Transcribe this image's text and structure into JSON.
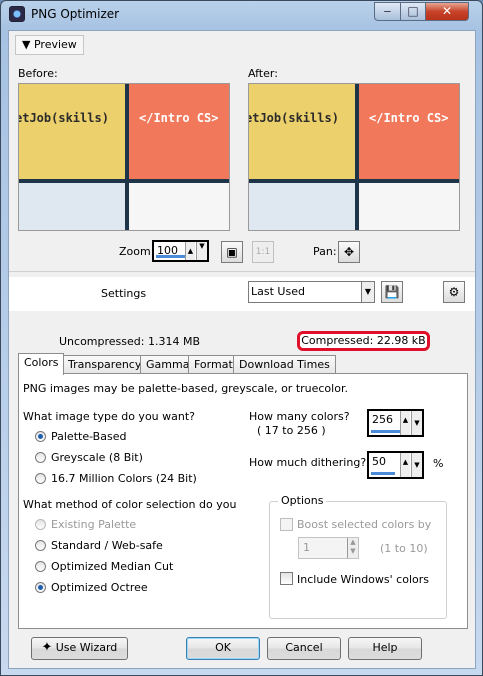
{
  "window": {
    "title": "PNG Optimizer"
  },
  "titlebar": {
    "min_glyph": "‒",
    "max_glyph": "□",
    "close_glyph": "✕"
  },
  "preview": {
    "toggle_label": "Preview",
    "before_label": "Before:",
    "after_label": "After:",
    "tile_yellow_text": "etJob(skills)",
    "tile_red_text": "</Intro CS>"
  },
  "zoom": {
    "label": "Zoom:",
    "value": "100"
  },
  "pan": {
    "label": "Pan:"
  },
  "settings": {
    "label": "Settings",
    "preset": "Last Used"
  },
  "sizes": {
    "uncompressed": "Uncompressed:  1.314 MB",
    "compressed": "Compressed: 22.98 kB"
  },
  "tabs": [
    "Colors",
    "Transparency",
    "Gamma",
    "Format",
    "Download Times"
  ],
  "colors_tab": {
    "intro": "PNG images may be palette-based, greyscale, or truecolor.",
    "type_question": "What image type do you want?",
    "type_options": [
      "Palette-Based",
      "Greyscale (8 Bit)",
      "16.7 Million Colors (24 Bit)"
    ],
    "type_selected": 0,
    "num_colors_label": "How many colors?",
    "num_colors_range": "( 17  to   256  )",
    "num_colors_value": "256",
    "dithering_label": "How much dithering?",
    "dithering_value": "50",
    "dithering_unit": "%",
    "method_question": "What method of color selection do you",
    "method_options": [
      "Existing Palette",
      "Standard / Web-safe",
      "Optimized Median Cut",
      "Optimized Octree"
    ],
    "method_selected": 3,
    "options_title": "Options",
    "boost_label": "Boost selected colors by",
    "boost_value": "1",
    "boost_range": "(1 to 10)",
    "include_windows_label": "Include Windows' colors"
  },
  "buttons": {
    "wizard": "Use Wizard",
    "ok": "OK",
    "cancel": "Cancel",
    "help": "Help"
  }
}
